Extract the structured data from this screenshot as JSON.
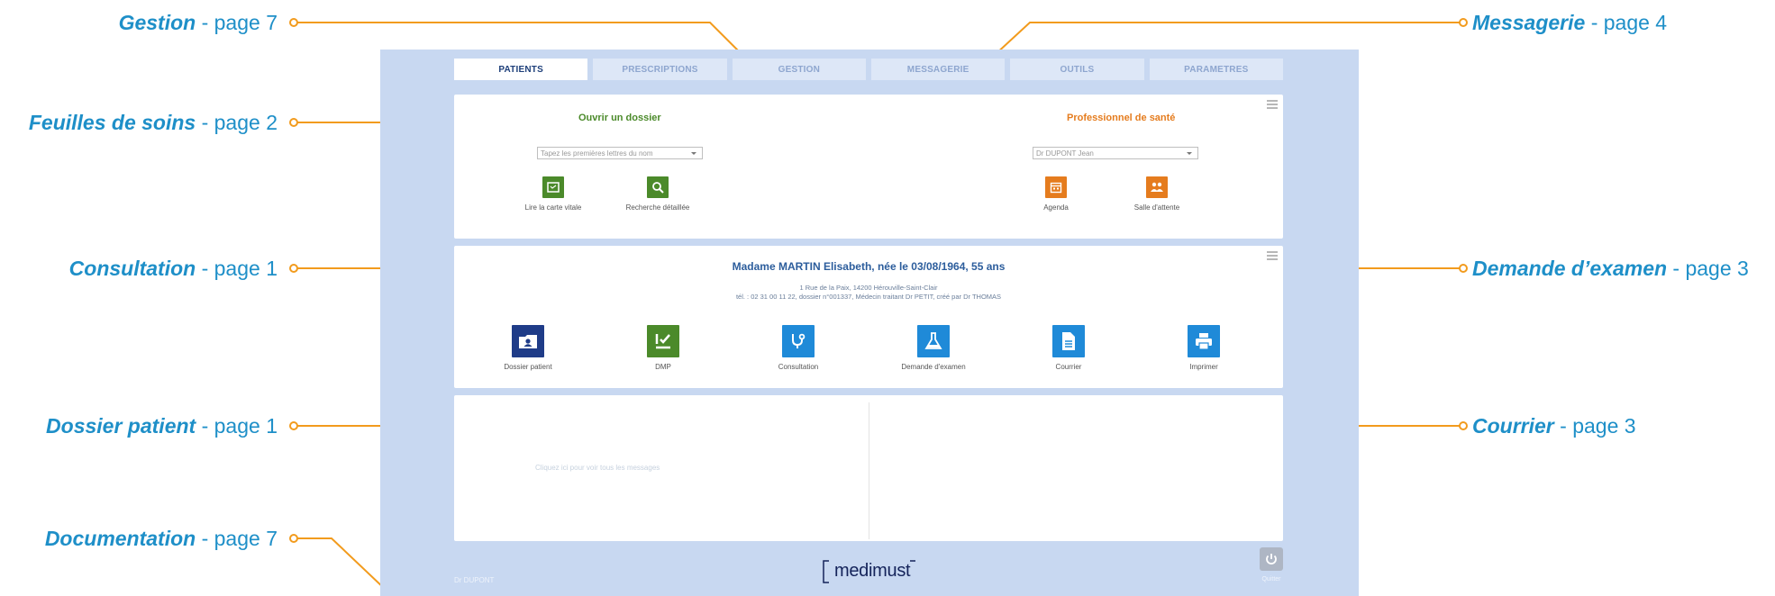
{
  "callouts": [
    {
      "name": "Gestion",
      "suffix": " - page 7"
    },
    {
      "name": "Messagerie",
      "suffix": " - page 4"
    },
    {
      "name": "Feuilles de soins",
      "suffix": " - page 2"
    },
    {
      "name": "Consultation",
      "suffix": " - page 1"
    },
    {
      "name": "Demande d’examen",
      "suffix": " - page 3"
    },
    {
      "name": "Dossier patient",
      "suffix": " - page 1"
    },
    {
      "name": "Courrier",
      "suffix": " - page 3"
    },
    {
      "name": "Documentation",
      "suffix": " - page 7"
    }
  ],
  "colors": {
    "callout_line": "#f29b1d",
    "callout_text": "#1e8fc8",
    "app_bg": "#c8d8f1",
    "green": "#4b8a2a",
    "orange": "#e57c1e",
    "blue": "#1f8ad8",
    "navy": "#1f3c88"
  },
  "tabs": [
    "PATIENTS",
    "PRESCRIPTIONS",
    "GESTION",
    "MESSAGERIE",
    "OUTILS",
    "PARAMETRES"
  ],
  "open_file": {
    "title": "Ouvrir un dossier",
    "search_placeholder": "Tapez les premières lettres du nom",
    "actions": [
      {
        "label": "Lire la carte vitale",
        "icon": "card-reader-icon"
      },
      {
        "label": "Recherche détaillée",
        "icon": "search-icon"
      }
    ]
  },
  "professional": {
    "title": "Professionnel de santé",
    "selected": "Dr DUPONT Jean",
    "actions": [
      {
        "label": "Agenda",
        "icon": "calendar-icon"
      },
      {
        "label": "Salle d'attente",
        "icon": "waiting-room-icon"
      }
    ]
  },
  "patient": {
    "name": "Madame MARTIN Elisabeth, née le 03/08/1964, 55 ans",
    "address": "1 Rue de la Paix, 14200 Hérouville-Saint-Clair",
    "details": "tél. : 02 31 00 11 22, dossier n°001337, Médecin traitant Dr PETIT, créé par Dr THOMAS",
    "actions": [
      {
        "label": "Dossier patient",
        "icon": "patient-file-icon"
      },
      {
        "label": "DMP",
        "icon": "dmp-icon"
      },
      {
        "label": "Consultation",
        "icon": "stethoscope-icon"
      },
      {
        "label": "Demande d'examen",
        "icon": "flask-icon"
      },
      {
        "label": "Courrier",
        "icon": "document-icon"
      },
      {
        "label": "Imprimer",
        "icon": "printer-icon"
      }
    ]
  },
  "messages": {
    "hint": "Cliquez ici pour voir tous les messages"
  },
  "footer": {
    "user": "Dr DUPONT",
    "logo": "medimust",
    "quit": "Quitter"
  }
}
